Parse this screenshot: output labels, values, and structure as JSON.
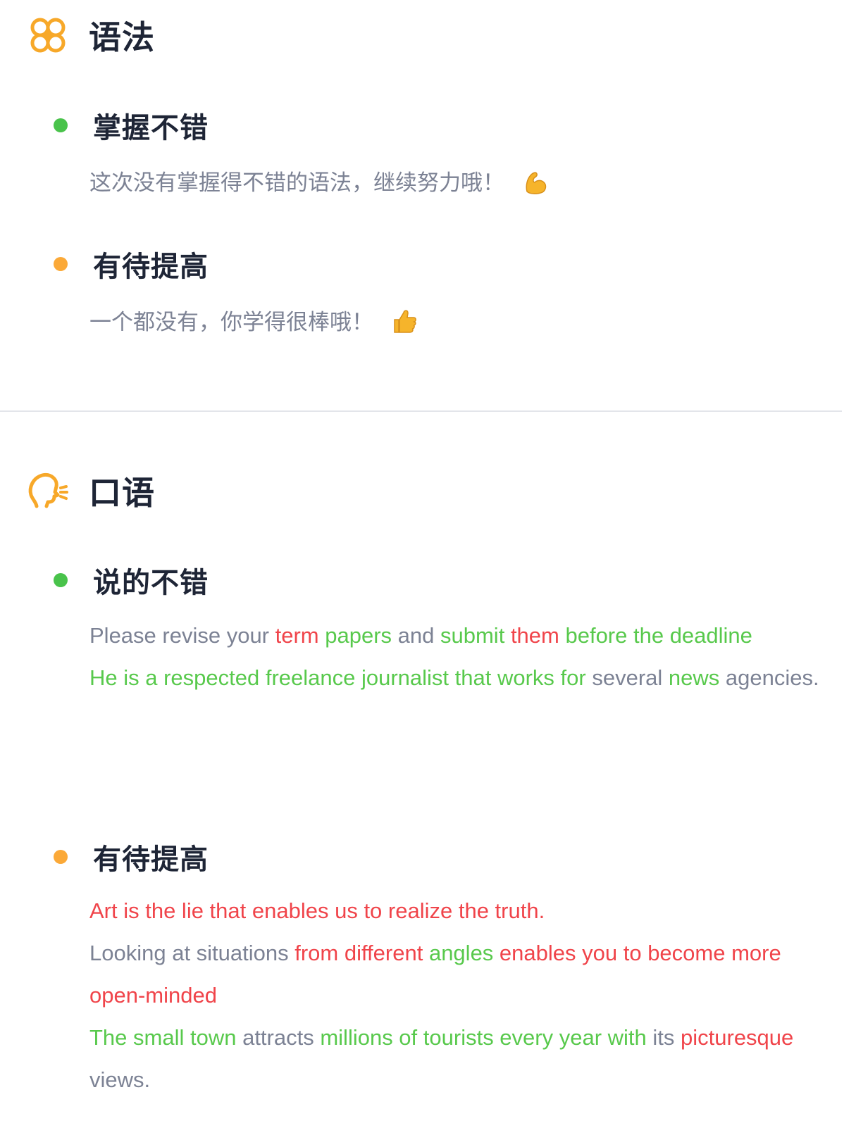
{
  "colors": {
    "accent_orange": "#f7a829",
    "dot_green": "#49c34b",
    "dot_orange": "#fba938",
    "word_green": "#58c94c",
    "word_red": "#f0444a",
    "word_gray": "#7c8294",
    "heading": "#1e2536"
  },
  "grammar": {
    "icon": "grammar-knot-icon",
    "title": "语法",
    "good": {
      "title": "掌握不错",
      "text": "这次没有掌握得不错的语法，继续努力哦！",
      "emoji": "flexed-biceps-emoji"
    },
    "improve": {
      "title": "有待提高",
      "text": "一个都没有，你学得很棒哦！",
      "emoji": "thumbs-up-emoji"
    }
  },
  "speaking": {
    "icon": "speaking-head-icon",
    "title": "口语",
    "good": {
      "title": "说的不错",
      "sentences": [
        [
          {
            "t": "Please revise your ",
            "c": "gray"
          },
          {
            "t": "term",
            "c": "red"
          },
          {
            "t": " ",
            "c": "gray"
          },
          {
            "t": "papers",
            "c": "green"
          },
          {
            "t": " and ",
            "c": "gray"
          },
          {
            "t": "submit",
            "c": "green"
          },
          {
            "t": " ",
            "c": "gray"
          },
          {
            "t": "them",
            "c": "red"
          },
          {
            "t": " before the deadline",
            "c": "green"
          }
        ],
        [
          {
            "t": "He is a respected freelance journalist that works for",
            "c": "green"
          },
          {
            "t": " several ",
            "c": "gray"
          },
          {
            "t": "news",
            "c": "green"
          },
          {
            "t": " agencies.",
            "c": "gray"
          }
        ]
      ]
    },
    "improve": {
      "title": "有待提高",
      "sentences": [
        [
          {
            "t": "Art is the lie that enables us to realize the truth.",
            "c": "red"
          }
        ],
        [
          {
            "t": "Looking at situations ",
            "c": "gray"
          },
          {
            "t": "from different",
            "c": "red"
          },
          {
            "t": " ",
            "c": "gray"
          },
          {
            "t": "angles",
            "c": "green"
          },
          {
            "t": " enables you to become more open-minded",
            "c": "red"
          }
        ],
        [
          {
            "t": "The small town",
            "c": "green"
          },
          {
            "t": " attracts ",
            "c": "gray"
          },
          {
            "t": "millions of tourists every year with",
            "c": "green"
          },
          {
            "t": " its ",
            "c": "gray"
          },
          {
            "t": "picturesque",
            "c": "red"
          },
          {
            "t": " views.",
            "c": "gray"
          }
        ]
      ]
    }
  }
}
